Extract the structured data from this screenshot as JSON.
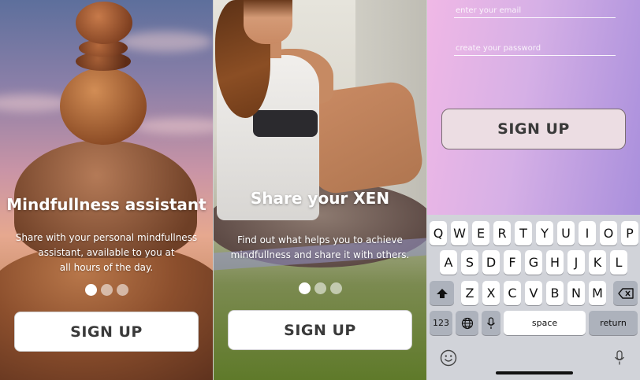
{
  "screens": [
    {
      "title": "Mindfullness assistant",
      "description": "Share with your personal mindfullness assistant, available to you at all hours of the day.",
      "description_lines": [
        "Share with your personal mindfullness",
        "assistant, available to you at",
        "all hours of the day."
      ],
      "active_dot": 0,
      "signup_label": "SIGN UP"
    },
    {
      "title": "Share your XEN",
      "description_lines": [
        "Find out what helps you to achieve",
        "mindfullness and share it with others."
      ],
      "active_dot": 0,
      "signup_label": "SIGN UP"
    }
  ],
  "signup_form": {
    "email_placeholder": "enter your email",
    "password_placeholder": "create your password",
    "signup_label": "SIGN UP"
  },
  "keyboard": {
    "row1": [
      "Q",
      "W",
      "E",
      "R",
      "T",
      "Y",
      "U",
      "I",
      "O",
      "P"
    ],
    "row2": [
      "A",
      "S",
      "D",
      "F",
      "G",
      "H",
      "J",
      "K",
      "L"
    ],
    "row3": [
      "Z",
      "X",
      "C",
      "V",
      "B",
      "N",
      "M"
    ],
    "numbers_key": "123",
    "space_key": "space",
    "return_key": "return",
    "icons": {
      "shift": "shift-icon",
      "delete": "backspace-icon",
      "globe": "globe-icon",
      "mic": "microphone-icon",
      "emoji": "emoji-icon",
      "dictation": "dictation-microphone-icon"
    }
  },
  "colors": {
    "form_gradient_start": "#f0b8e6",
    "form_gradient_end": "#a98fdc",
    "signup_form_button": "#ecdde3",
    "keyboard_bg": "#d1d3d9"
  }
}
